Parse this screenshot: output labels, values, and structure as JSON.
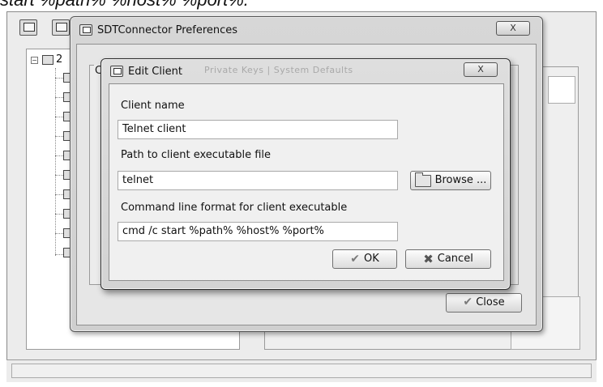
{
  "caption": "start %path% %host% %port%.",
  "pref_dialog": {
    "title": "SDTConnector Preferences",
    "close_x": "X",
    "group_letter": "C",
    "close_label": "Close"
  },
  "tree": {
    "root_toggle": "−",
    "root_label": "2"
  },
  "edit_dialog": {
    "title": "Edit Client",
    "ghost_tabs": "Private Keys | System Defaults",
    "close_x": "X",
    "client_name_label": "Client name",
    "client_name_value": "Telnet client",
    "path_label": "Path to client executable file",
    "path_value": "telnet",
    "browse_label": "Browse ...",
    "cmd_label": "Command line format for client executable",
    "cmd_value": "cmd /c start %path% %host% %port%",
    "ok_label": "OK",
    "cancel_label": "Cancel"
  },
  "icons": {
    "app_toolbar": [
      "gateway-icon",
      "host-icon"
    ],
    "check": "✔",
    "cancel": "✖"
  }
}
